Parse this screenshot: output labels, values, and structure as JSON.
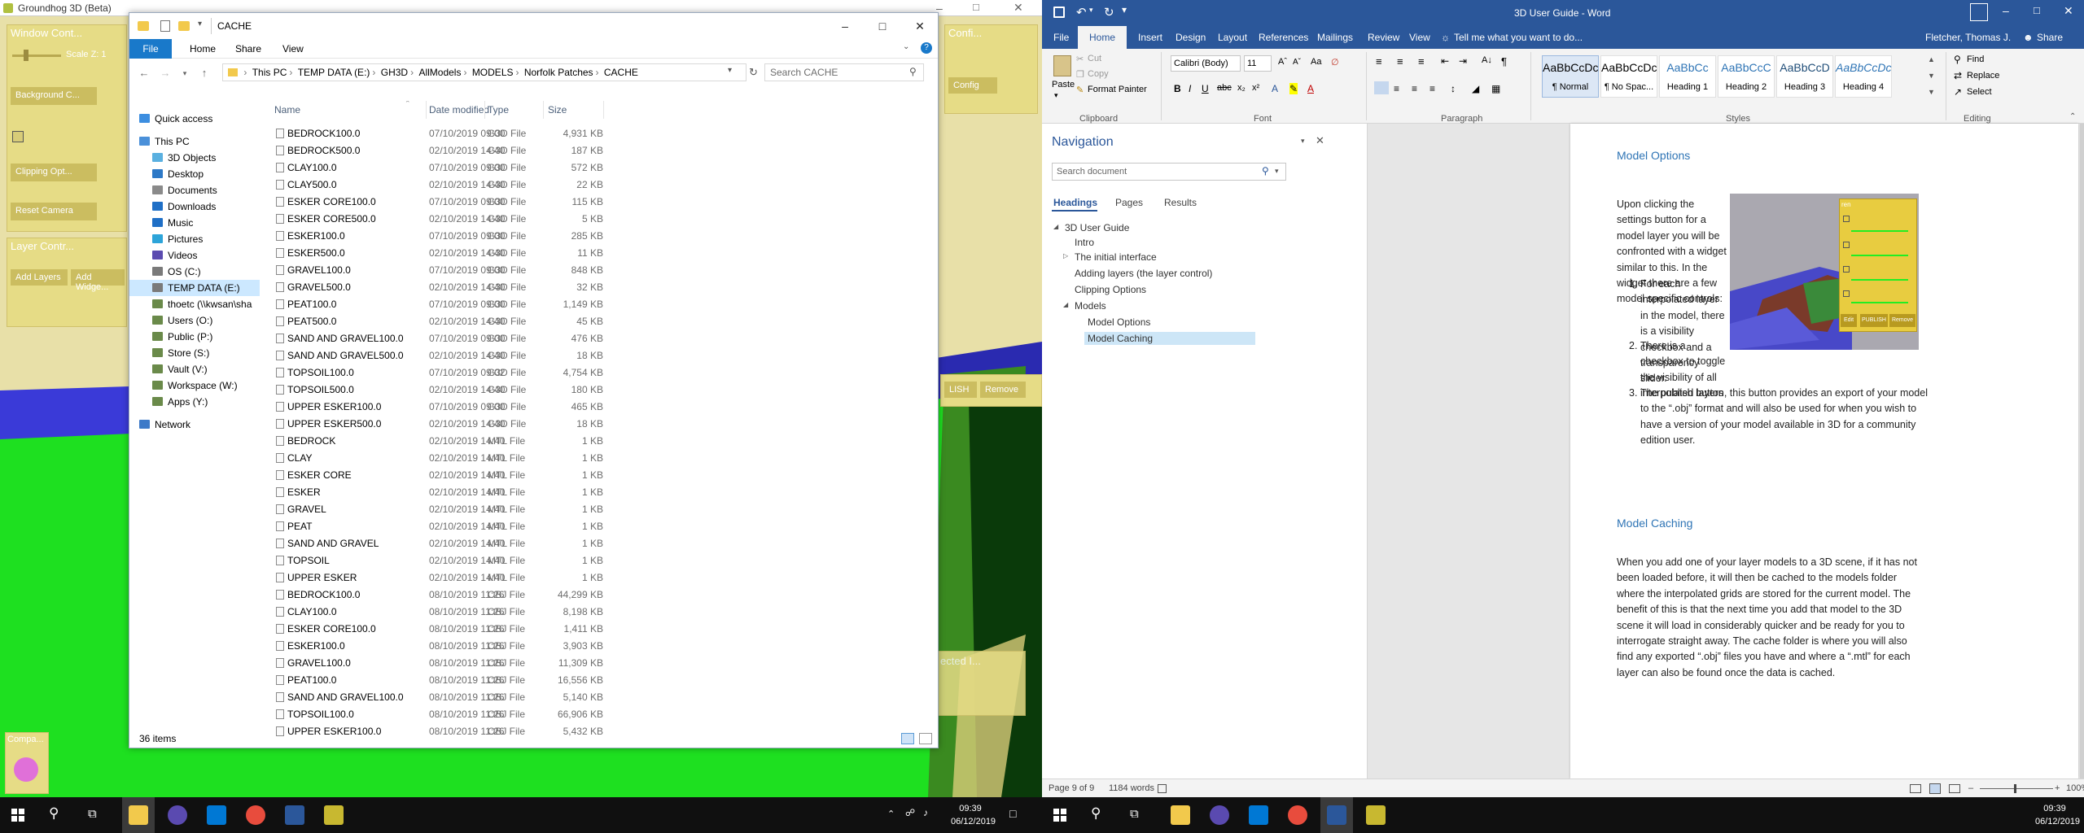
{
  "groundhog": {
    "title": "Groundhog 3D (Beta)",
    "window_control_label": "Window Cont...",
    "scale_label": "Scale Z: 1",
    "background_label": "Background C...",
    "clipping_label": "Clipping Opt...",
    "reset_camera_label": "Reset Camera",
    "layer_control_label": "Layer Contr...",
    "add_layers_label": "Add Layers",
    "add_widget_label": "Add Widge...",
    "publish_label": "LISH",
    "remove_label": "Remove",
    "config_label": "Confi...",
    "config_btn_label": "Config",
    "selected_label": "ected I...",
    "compass_label": "Compa..."
  },
  "explorer": {
    "title": "CACHE",
    "tabs": [
      "File",
      "Home",
      "Share",
      "View"
    ],
    "breadcrumb": [
      "This PC",
      "TEMP DATA (E:)",
      "GH3D",
      "AllModels",
      "MODELS",
      "Norfolk Patches",
      "CACHE"
    ],
    "search_placeholder": "Search CACHE",
    "columns": [
      "Name",
      "Date modified",
      "Type",
      "Size"
    ],
    "nav": [
      "Quick access",
      "This PC",
      "3D Objects",
      "Desktop",
      "Documents",
      "Downloads",
      "Music",
      "Pictures",
      "Videos",
      "OS (C:)",
      "TEMP DATA (E:)",
      "thoetc (\\\\kwsan\\sha",
      "Users (O:)",
      "Public (P:)",
      "Store (S:)",
      "Vault (V:)",
      "Workspace (W:)",
      "Apps (Y:)",
      "Network"
    ],
    "files": [
      [
        "BEDROCK100.0",
        "07/10/2019 09:00",
        "G3D File",
        "4,931 KB"
      ],
      [
        "BEDROCK500.0",
        "02/10/2019 14:40",
        "G3D File",
        "187 KB"
      ],
      [
        "CLAY100.0",
        "07/10/2019 09:00",
        "G3D File",
        "572 KB"
      ],
      [
        "CLAY500.0",
        "02/10/2019 14:40",
        "G3D File",
        "22 KB"
      ],
      [
        "ESKER CORE100.0",
        "07/10/2019 09:00",
        "G3D File",
        "115 KB"
      ],
      [
        "ESKER CORE500.0",
        "02/10/2019 14:40",
        "G3D File",
        "5 KB"
      ],
      [
        "ESKER100.0",
        "07/10/2019 09:00",
        "G3D File",
        "285 KB"
      ],
      [
        "ESKER500.0",
        "02/10/2019 14:40",
        "G3D File",
        "11 KB"
      ],
      [
        "GRAVEL100.0",
        "07/10/2019 09:00",
        "G3D File",
        "848 KB"
      ],
      [
        "GRAVEL500.0",
        "02/10/2019 14:40",
        "G3D File",
        "32 KB"
      ],
      [
        "PEAT100.0",
        "07/10/2019 09:00",
        "G3D File",
        "1,149 KB"
      ],
      [
        "PEAT500.0",
        "02/10/2019 14:40",
        "G3D File",
        "45 KB"
      ],
      [
        "SAND AND GRAVEL100.0",
        "07/10/2019 09:00",
        "G3D File",
        "476 KB"
      ],
      [
        "SAND AND GRAVEL500.0",
        "02/10/2019 14:40",
        "G3D File",
        "18 KB"
      ],
      [
        "TOPSOIL100.0",
        "07/10/2019 09:02",
        "G3D File",
        "4,754 KB"
      ],
      [
        "TOPSOIL500.0",
        "02/10/2019 14:40",
        "G3D File",
        "180 KB"
      ],
      [
        "UPPER ESKER100.0",
        "07/10/2019 09:00",
        "G3D File",
        "465 KB"
      ],
      [
        "UPPER ESKER500.0",
        "02/10/2019 14:40",
        "G3D File",
        "18 KB"
      ],
      [
        "BEDROCK",
        "02/10/2019 14:40",
        "MTL File",
        "1 KB"
      ],
      [
        "CLAY",
        "02/10/2019 14:40",
        "MTL File",
        "1 KB"
      ],
      [
        "ESKER CORE",
        "02/10/2019 14:40",
        "MTL File",
        "1 KB"
      ],
      [
        "ESKER",
        "02/10/2019 14:40",
        "MTL File",
        "1 KB"
      ],
      [
        "GRAVEL",
        "02/10/2019 14:40",
        "MTL File",
        "1 KB"
      ],
      [
        "PEAT",
        "02/10/2019 14:40",
        "MTL File",
        "1 KB"
      ],
      [
        "SAND AND GRAVEL",
        "02/10/2019 14:40",
        "MTL File",
        "1 KB"
      ],
      [
        "TOPSOIL",
        "02/10/2019 14:40",
        "MTL File",
        "1 KB"
      ],
      [
        "UPPER ESKER",
        "02/10/2019 14:40",
        "MTL File",
        "1 KB"
      ],
      [
        "BEDROCK100.0",
        "08/10/2019 11:26",
        "OBJ File",
        "44,299 KB"
      ],
      [
        "CLAY100.0",
        "08/10/2019 11:26",
        "OBJ File",
        "8,198 KB"
      ],
      [
        "ESKER CORE100.0",
        "08/10/2019 11:26",
        "OBJ File",
        "1,411 KB"
      ],
      [
        "ESKER100.0",
        "08/10/2019 11:26",
        "OBJ File",
        "3,903 KB"
      ],
      [
        "GRAVEL100.0",
        "08/10/2019 11:26",
        "OBJ File",
        "11,309 KB"
      ],
      [
        "PEAT100.0",
        "08/10/2019 11:26",
        "OBJ File",
        "16,556 KB"
      ],
      [
        "SAND AND GRAVEL100.0",
        "08/10/2019 11:26",
        "OBJ File",
        "5,140 KB"
      ],
      [
        "TOPSOIL100.0",
        "08/10/2019 11:26",
        "OBJ File",
        "66,906 KB"
      ],
      [
        "UPPER ESKER100.0",
        "08/10/2019 11:26",
        "OBJ File",
        "5,432 KB"
      ]
    ],
    "status": "36 items"
  },
  "word": {
    "title": "3D User Guide - Word",
    "user": "Fletcher, Thomas J.",
    "share": "Share",
    "tabs": [
      "File",
      "Home",
      "Insert",
      "Design",
      "Layout",
      "References",
      "Mailings",
      "Review",
      "View"
    ],
    "tell_me": "Tell me what you want to do...",
    "clipboard": {
      "paste": "Paste",
      "cut": "Cut",
      "copy": "Copy",
      "format_painter": "Format Painter",
      "group": "Clipboard"
    },
    "font": {
      "name": "Calibri (Body)",
      "size": "11",
      "group": "Font"
    },
    "paragraph_group": "Paragraph",
    "styles_group": "Styles",
    "editing": {
      "find": "Find",
      "replace": "Replace",
      "select": "Select",
      "group": "Editing"
    },
    "styles": [
      {
        "sample": "AaBbCcDc",
        "label": "¶ Normal"
      },
      {
        "sample": "AaBbCcDc",
        "label": "¶ No Spac..."
      },
      {
        "sample": "AaBbCc",
        "label": "Heading 1"
      },
      {
        "sample": "AaBbCcC",
        "label": "Heading 2"
      },
      {
        "sample": "AaBbCcD",
        "label": "Heading 3"
      },
      {
        "sample": "AaBbCcDc",
        "label": "Heading 4"
      }
    ],
    "nav": {
      "title": "Navigation",
      "search": "Search document",
      "tabs": [
        "Headings",
        "Pages",
        "Results"
      ],
      "headings": [
        "3D User Guide",
        "Intro",
        "The initial interface",
        "Adding layers (the layer control)",
        "Clipping Options",
        "Models",
        "Model Options",
        "Model Caching"
      ]
    },
    "doc": {
      "h1": "Model Options",
      "p1": "Upon clicking the settings button for a model layer you will be confronted with a widget similar to this. In the widget there are a few model specific controls:",
      "items": [
        "For each interpolated layer in the model, there is a visibility checkbox and a transparency slider.",
        "There is a checkbox to toggle the visibility of all interpolated layers",
        "The publish button, this button provides an export of your model to the “.obj” format and will also be used for when you wish to have a version of your model available in 3D for a community edition user."
      ],
      "h2": "Model Caching",
      "p2": "When you add one of your layer models to a 3D scene, if it has not been loaded before, it will then be cached to the models folder where the interpolated grids are stored for the current model. The benefit of this is that the next time you add that model to the 3D scene it will load in considerably quicker and be ready for you to interrogate straight away. The cache folder is where you will also find any exported “.obj” files you have and where a “.mtl” for each layer can also be found once the data is cached.",
      "widget_title": "ren",
      "widget_buttons": [
        "Edit",
        "PUBLISH",
        "Remove"
      ]
    },
    "status": {
      "page": "Page 9 of 9",
      "words": "1184 words",
      "zoom": "100%"
    }
  },
  "taskbar": {
    "time": "09:39",
    "date": "06/12/2019"
  }
}
